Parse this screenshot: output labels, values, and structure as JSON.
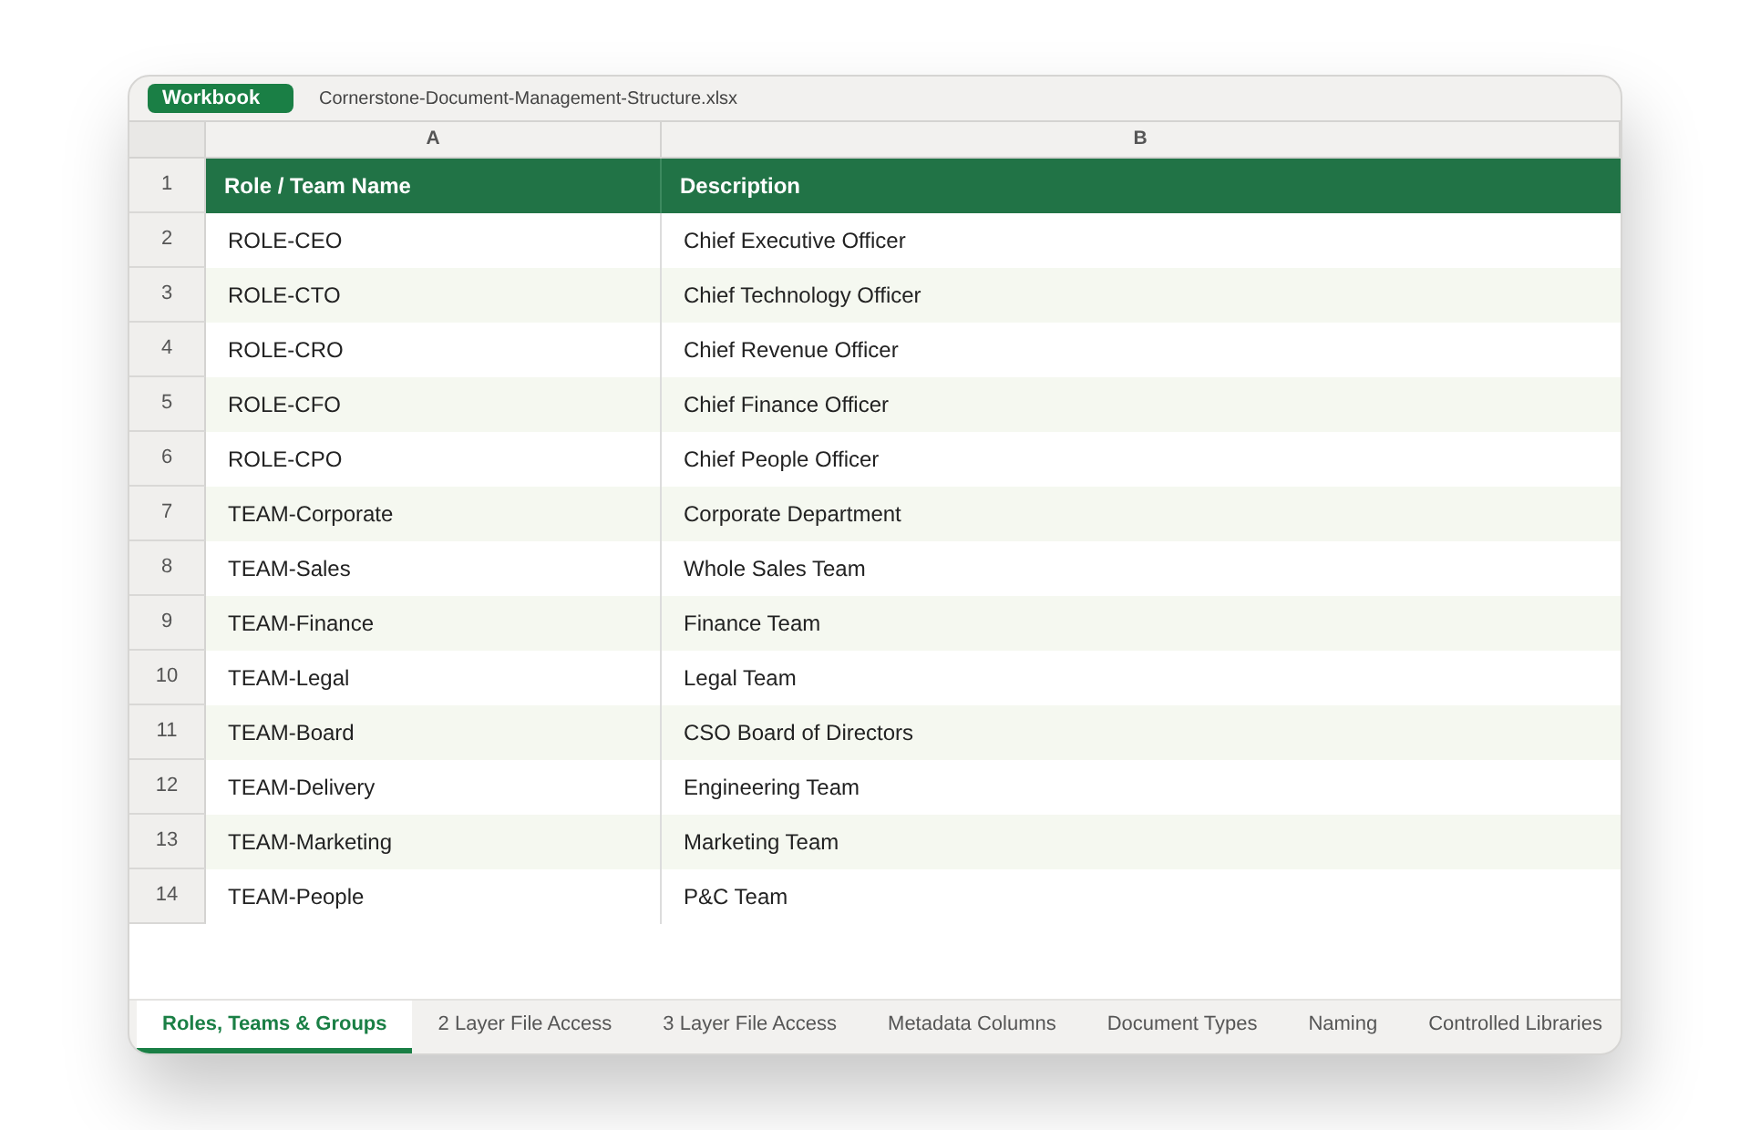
{
  "window": {
    "tag": "Workbook",
    "file_name": "Cornerstone-Document-Management-Structure.xlsx"
  },
  "sheet": {
    "columns": [
      "A",
      "B"
    ],
    "header_row": {
      "number": "1",
      "cells": [
        "Role / Team Name",
        "Description"
      ]
    },
    "rows": [
      {
        "number": "2",
        "cells": [
          "ROLE-CEO",
          "Chief Executive Officer"
        ]
      },
      {
        "number": "3",
        "cells": [
          "ROLE-CTO",
          "Chief Technology Officer"
        ]
      },
      {
        "number": "4",
        "cells": [
          "ROLE-CRO",
          "Chief Revenue Officer"
        ]
      },
      {
        "number": "5",
        "cells": [
          "ROLE-CFO",
          "Chief Finance Officer"
        ]
      },
      {
        "number": "6",
        "cells": [
          "ROLE-CPO",
          "Chief People Officer"
        ]
      },
      {
        "number": "7",
        "cells": [
          "TEAM-Corporate",
          "Corporate Department"
        ]
      },
      {
        "number": "8",
        "cells": [
          "TEAM-Sales",
          "Whole Sales Team"
        ]
      },
      {
        "number": "9",
        "cells": [
          "TEAM-Finance",
          "Finance Team"
        ]
      },
      {
        "number": "10",
        "cells": [
          "TEAM-Legal",
          "Legal Team"
        ]
      },
      {
        "number": "11",
        "cells": [
          "TEAM-Board",
          "CSO Board of Directors"
        ]
      },
      {
        "number": "12",
        "cells": [
          "TEAM-Delivery",
          "Engineering Team"
        ]
      },
      {
        "number": "13",
        "cells": [
          "TEAM-Marketing",
          "Marketing Team"
        ]
      },
      {
        "number": "14",
        "cells": [
          "TEAM-People",
          "P&C Team"
        ]
      }
    ]
  },
  "tabs": [
    {
      "label": "Roles, Teams & Groups",
      "selected": true
    },
    {
      "label": "2 Layer File Access",
      "selected": false
    },
    {
      "label": "3 Layer File Access",
      "selected": false
    },
    {
      "label": "Metadata Columns",
      "selected": false
    },
    {
      "label": "Document Types",
      "selected": false
    },
    {
      "label": "Naming",
      "selected": false
    },
    {
      "label": "Controlled Libraries",
      "selected": false
    }
  ]
}
